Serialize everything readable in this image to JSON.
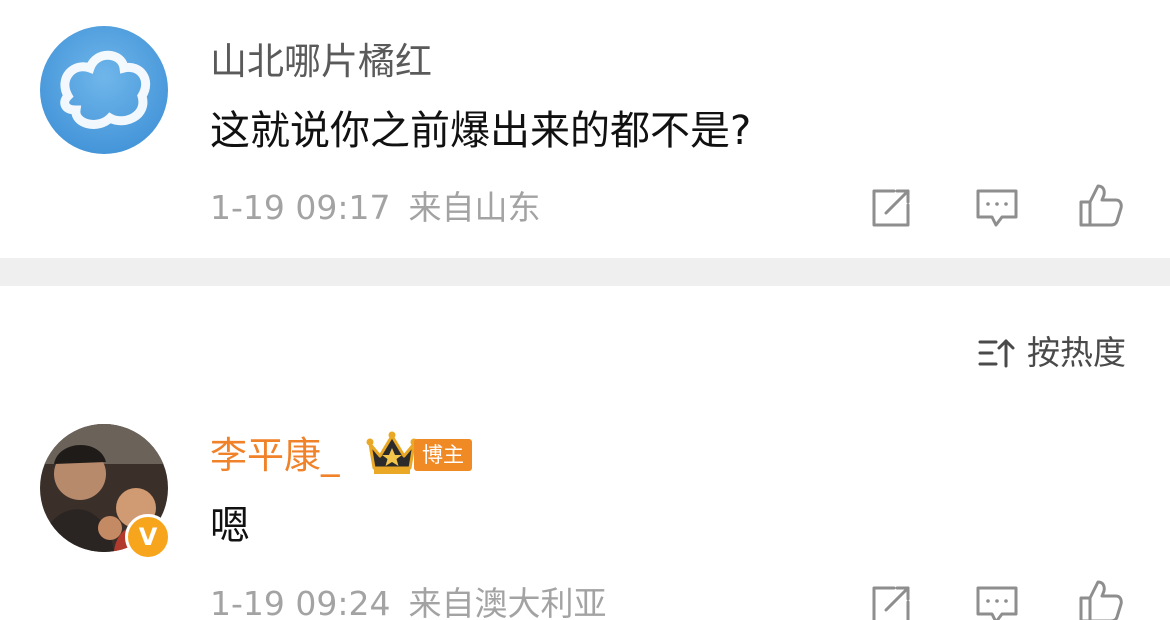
{
  "comments": [
    {
      "username": "山北哪片橘红",
      "text": "这就说你之前爆出来的都不是?",
      "date": "1-19 09:17",
      "location": "来自山东"
    },
    {
      "username": "李平康_",
      "badge_label": "博主",
      "text": "嗯",
      "date": "1-19 09:24",
      "location": "来自澳大利亚",
      "verified_mark": "V"
    }
  ],
  "sort": {
    "label": "按热度"
  },
  "colors": {
    "username_default": "#5a5a5a",
    "username_vip": "#f0822a",
    "meta": "#a3a3a3",
    "badge": "#f08a24",
    "verified": "#f7a51c",
    "divider": "#efefef"
  },
  "icons": [
    "share-icon",
    "comment-icon",
    "like-icon",
    "crown-icon",
    "sort-icon",
    "verified-icon"
  ]
}
